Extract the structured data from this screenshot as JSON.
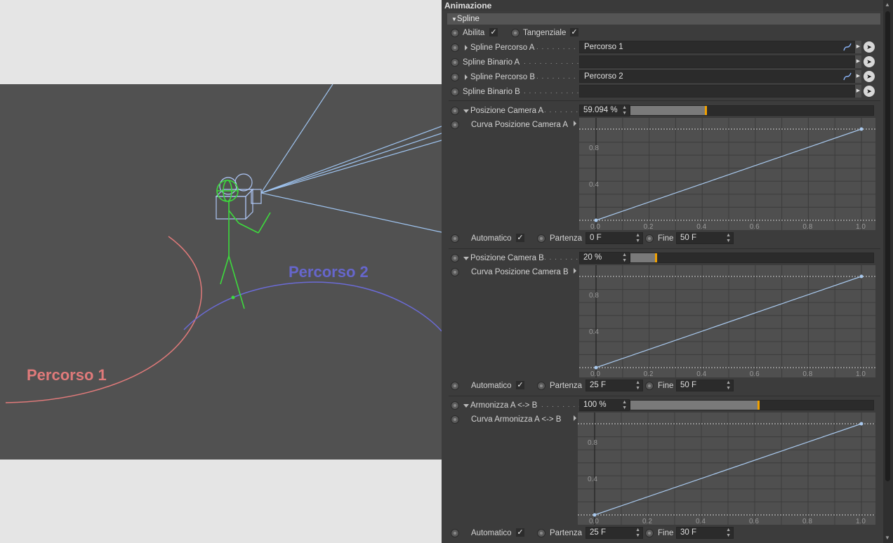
{
  "viewport": {
    "label_path1": "Percorso 1",
    "label_path2": "Percorso 2",
    "color_path1": "#e07a7a",
    "color_path2": "#6666cc"
  },
  "panel": {
    "title": "Animazione",
    "group": "Spline",
    "abilita": {
      "label": "Abilita",
      "checked": true
    },
    "tangenziale": {
      "label": "Tangenziale",
      "checked": true
    },
    "spline_percorso_a": {
      "label": "Spline Percorso A",
      "value": "Percorso 1"
    },
    "spline_binario_a": {
      "label": "Spline Binario A",
      "value": ""
    },
    "spline_percorso_b": {
      "label": "Spline Percorso B",
      "value": "Percorso 2"
    },
    "spline_binario_b": {
      "label": "Spline Binario B",
      "value": ""
    },
    "posizione_a": {
      "label": "Posizione Camera A",
      "value": "59.094 %",
      "fraction": 0.59094,
      "curve_label": "Curva Posizione Camera A",
      "automatico": "Automatico",
      "partenza_label": "Partenza",
      "partenza": "0 F",
      "fine_label": "Fine",
      "fine": "50 F"
    },
    "posizione_b": {
      "label": "Posizione Camera B",
      "value": "20 %",
      "fraction": 0.2,
      "curve_label": "Curva Posizione Camera B",
      "automatico": "Automatico",
      "partenza_label": "Partenza",
      "partenza": "25 F",
      "fine_label": "Fine",
      "fine": "50 F"
    },
    "armonizza": {
      "label": "Armonizza A <-> B",
      "value": "100 %",
      "fraction": 1.0,
      "curve_label": "Curva Armonizza  A <-> B",
      "automatico": "Automatico",
      "partenza_label": "Partenza",
      "partenza": "25 F",
      "fine_label": "Fine",
      "fine": "30 F"
    },
    "curve_axis": {
      "y_ticks": [
        "0.8",
        "0.4"
      ],
      "x_ticks": [
        "0.0",
        "0.2",
        "0.4",
        "0.6",
        "0.8",
        "1.0"
      ]
    },
    "accent_color": "#f0a000"
  }
}
